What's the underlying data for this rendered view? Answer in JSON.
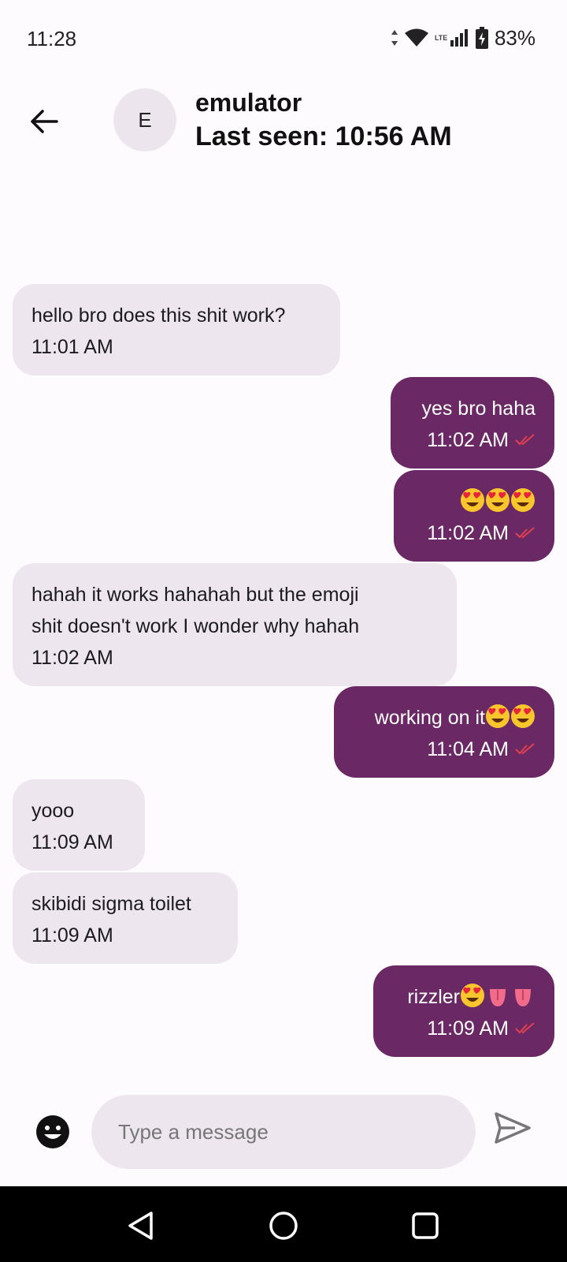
{
  "status_bar": {
    "time": "11:28",
    "network_type": "LTE",
    "battery_percent": "83%",
    "icons": [
      "data-arrows-icon",
      "wifi-icon",
      "lte-icon",
      "signal-icon",
      "battery-icon"
    ]
  },
  "header": {
    "avatar_letter": "E",
    "contact_name": "emulator",
    "last_seen": "Last seen: 10:56 AM"
  },
  "colors": {
    "incoming_bubble": "#ede6ee",
    "outgoing_bubble": "#6a2864",
    "read_check": "#e04050",
    "background": "#fefbfe"
  },
  "messages": [
    {
      "direction": "in",
      "text": "hello bro does this shit work?",
      "time": "11:01 AM"
    },
    {
      "direction": "out",
      "text": "yes bro haha",
      "time": "11:02 AM",
      "status": "read"
    },
    {
      "direction": "out",
      "text": "😍😍😍",
      "time": "11:02 AM",
      "status": "read"
    },
    {
      "direction": "in",
      "text_lines": [
        "hahah it works hahahah but the emoji",
        "shit doesn't work I wonder why hahah"
      ],
      "time": "11:02 AM"
    },
    {
      "direction": "out",
      "text": "working on it😍😍",
      "time": "11:04 AM",
      "status": "read"
    },
    {
      "direction": "in",
      "text": "yooo",
      "time": "11:09 AM"
    },
    {
      "direction": "in",
      "text": "skibidi sigma toilet",
      "time": "11:09 AM"
    },
    {
      "direction": "out",
      "text": "rizzler😍👅👅",
      "time": "11:09 AM",
      "status": "read"
    }
  ],
  "input": {
    "placeholder": "Type a message",
    "emoji_button_icon": "smiley-icon",
    "send_button_icon": "send-icon"
  },
  "nav_bar": {
    "buttons": [
      "back-triangle-icon",
      "home-circle-icon",
      "recents-square-icon"
    ]
  }
}
